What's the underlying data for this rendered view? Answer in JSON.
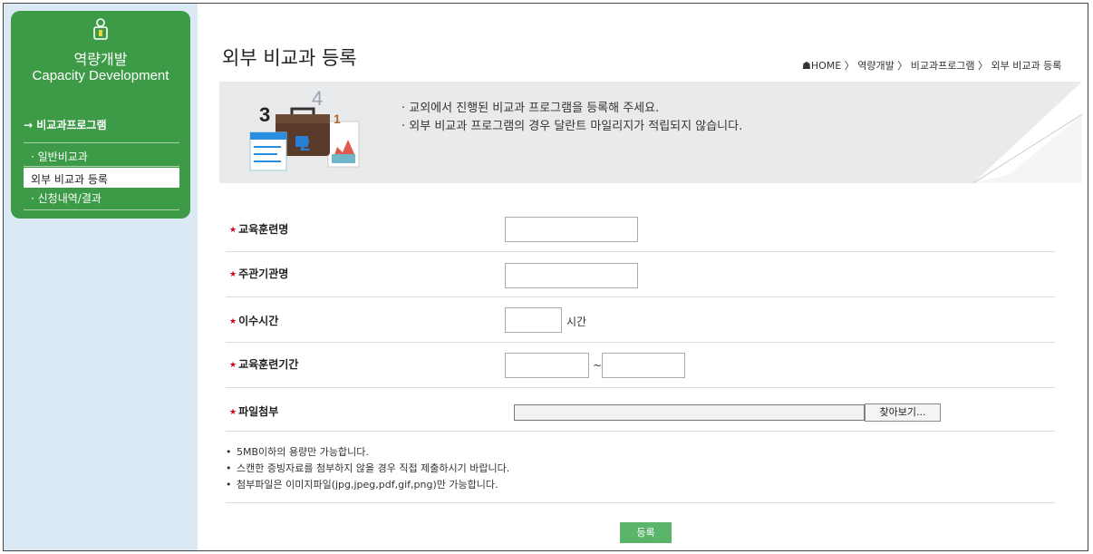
{
  "sidebar": {
    "title": "역량개발",
    "subtitle": "Capacity Development",
    "section": "→ 비교과프로그램",
    "items": [
      {
        "label": "· 일반비교과"
      },
      {
        "label": "외부 비교과 등록"
      },
      {
        "label": "· 신청내역/결과"
      }
    ]
  },
  "header": {
    "title": "외부 비교과 등록",
    "breadcrumb": "HOME 〉 역량개발 〉 비교과프로그램 〉 외부 비교과 등록"
  },
  "banner": {
    "line1": "· 교외에서 진행된 비교과 프로그램을 등록해 주세요.",
    "line2": "· 외부 비교과 프로그램의 경우 달란트 마일리지가 적립되지 않습니다."
  },
  "form": {
    "fields": [
      {
        "label": "교육훈련명"
      },
      {
        "label": "주관기관명"
      },
      {
        "label": "이수시간",
        "unit": "시간"
      },
      {
        "label": "교육훈련기간",
        "separator": "~"
      },
      {
        "label": "파일첨부"
      }
    ],
    "file_button": "찾아보기...",
    "notes": [
      "5MB이하의 용량만 가능합니다.",
      "스캔한 증빙자료를 첨부하지 않을 경우 직접 제출하시기 바랍니다.",
      "첨부파일은 이미지파일(jpg,jpeg,pdf,gif,png)만 가능합니다."
    ],
    "submit": "등록"
  },
  "colors": {
    "sidebar_green": "#3d9b48",
    "sidebar_bg": "#dbe9f5",
    "required_star": "#d0021b",
    "submit_green": "#5ab56a"
  }
}
